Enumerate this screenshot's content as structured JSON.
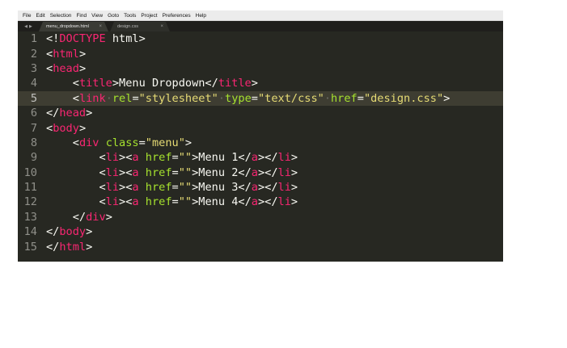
{
  "menubar": {
    "items": [
      "File",
      "Edit",
      "Selection",
      "Find",
      "View",
      "Goto",
      "Tools",
      "Project",
      "Preferences",
      "Help"
    ]
  },
  "tabs": [
    {
      "label": "menu_dropdown.html",
      "close": "×",
      "active": true
    },
    {
      "label": "design.css",
      "close": "×",
      "active": false
    }
  ],
  "tab_nav": {
    "prev": "◀",
    "next": "▶"
  },
  "editor": {
    "current_line": 5,
    "lines": [
      {
        "num": "1",
        "indent": "",
        "tokens": [
          [
            "p",
            "<!"
          ],
          [
            "t",
            "DOCTYPE"
          ],
          [
            "p",
            " html>"
          ]
        ]
      },
      {
        "num": "2",
        "indent": "",
        "tokens": [
          [
            "p",
            "<"
          ],
          [
            "t",
            "html"
          ],
          [
            "p",
            ">"
          ]
        ]
      },
      {
        "num": "3",
        "indent": "",
        "tokens": [
          [
            "p",
            "<"
          ],
          [
            "t",
            "head"
          ],
          [
            "p",
            ">"
          ]
        ]
      },
      {
        "num": "4",
        "indent": "    ",
        "tokens": [
          [
            "p",
            "<"
          ],
          [
            "t",
            "title"
          ],
          [
            "p",
            ">Menu Dropdown</"
          ],
          [
            "t",
            "title"
          ],
          [
            "p",
            ">"
          ]
        ]
      },
      {
        "num": "5",
        "indent": "    ",
        "tokens": [
          [
            "p",
            "<"
          ],
          [
            "t",
            "link"
          ],
          [
            "w",
            "·"
          ],
          [
            "a",
            "rel"
          ],
          [
            "p",
            "="
          ],
          [
            "s",
            "\"stylesheet\""
          ],
          [
            "w",
            "·"
          ],
          [
            "a",
            "type"
          ],
          [
            "p",
            "="
          ],
          [
            "s",
            "\"text/css\""
          ],
          [
            "w",
            "·"
          ],
          [
            "a",
            "href"
          ],
          [
            "p",
            "="
          ],
          [
            "s",
            "\"design.css\""
          ],
          [
            "p",
            ">"
          ]
        ]
      },
      {
        "num": "6",
        "indent": "",
        "tokens": [
          [
            "p",
            "</"
          ],
          [
            "t",
            "head"
          ],
          [
            "p",
            ">"
          ]
        ]
      },
      {
        "num": "7",
        "indent": "",
        "tokens": [
          [
            "p",
            "<"
          ],
          [
            "t",
            "body"
          ],
          [
            "p",
            ">"
          ]
        ]
      },
      {
        "num": "8",
        "indent": "    ",
        "tokens": [
          [
            "p",
            "<"
          ],
          [
            "t",
            "div"
          ],
          [
            "p",
            " "
          ],
          [
            "a",
            "class"
          ],
          [
            "p",
            "="
          ],
          [
            "s",
            "\"menu\""
          ],
          [
            "p",
            ">"
          ]
        ]
      },
      {
        "num": "9",
        "indent": "        ",
        "tokens": [
          [
            "p",
            "<"
          ],
          [
            "t",
            "li"
          ],
          [
            "p",
            "><"
          ],
          [
            "t",
            "a"
          ],
          [
            "p",
            " "
          ],
          [
            "a",
            "href"
          ],
          [
            "p",
            "="
          ],
          [
            "s",
            "\"\""
          ],
          [
            "p",
            ">Menu 1</"
          ],
          [
            "t",
            "a"
          ],
          [
            "p",
            "></"
          ],
          [
            "t",
            "li"
          ],
          [
            "p",
            ">"
          ]
        ]
      },
      {
        "num": "10",
        "indent": "        ",
        "tokens": [
          [
            "p",
            "<"
          ],
          [
            "t",
            "li"
          ],
          [
            "p",
            "><"
          ],
          [
            "t",
            "a"
          ],
          [
            "p",
            " "
          ],
          [
            "a",
            "href"
          ],
          [
            "p",
            "="
          ],
          [
            "s",
            "\"\""
          ],
          [
            "p",
            ">Menu 2</"
          ],
          [
            "t",
            "a"
          ],
          [
            "p",
            "></"
          ],
          [
            "t",
            "li"
          ],
          [
            "p",
            ">"
          ]
        ]
      },
      {
        "num": "11",
        "indent": "        ",
        "tokens": [
          [
            "p",
            "<"
          ],
          [
            "t",
            "li"
          ],
          [
            "p",
            "><"
          ],
          [
            "t",
            "a"
          ],
          [
            "p",
            " "
          ],
          [
            "a",
            "href"
          ],
          [
            "p",
            "="
          ],
          [
            "s",
            "\"\""
          ],
          [
            "p",
            ">Menu 3</"
          ],
          [
            "t",
            "a"
          ],
          [
            "p",
            "></"
          ],
          [
            "t",
            "li"
          ],
          [
            "p",
            ">"
          ]
        ]
      },
      {
        "num": "12",
        "indent": "        ",
        "tokens": [
          [
            "p",
            "<"
          ],
          [
            "t",
            "li"
          ],
          [
            "p",
            "><"
          ],
          [
            "t",
            "a"
          ],
          [
            "p",
            " "
          ],
          [
            "a",
            "href"
          ],
          [
            "p",
            "="
          ],
          [
            "s",
            "\"\""
          ],
          [
            "p",
            ">Menu 4</"
          ],
          [
            "t",
            "a"
          ],
          [
            "p",
            "></"
          ],
          [
            "t",
            "li"
          ],
          [
            "p",
            ">"
          ]
        ]
      },
      {
        "num": "13",
        "indent": "    ",
        "tokens": [
          [
            "p",
            "</"
          ],
          [
            "t",
            "div"
          ],
          [
            "p",
            ">"
          ]
        ]
      },
      {
        "num": "14",
        "indent": "",
        "tokens": [
          [
            "p",
            "</"
          ],
          [
            "t",
            "body"
          ],
          [
            "p",
            ">"
          ]
        ]
      },
      {
        "num": "15",
        "indent": "",
        "tokens": [
          [
            "p",
            "</"
          ],
          [
            "t",
            "html"
          ],
          [
            "p",
            ">"
          ]
        ]
      }
    ]
  },
  "colors": {
    "background": "#272822",
    "tag": "#f92672",
    "attribute": "#a6e22e",
    "string": "#e6db74",
    "text": "#f8f8f2",
    "line_number": "#90908a",
    "current_line": "#3e3d32"
  }
}
